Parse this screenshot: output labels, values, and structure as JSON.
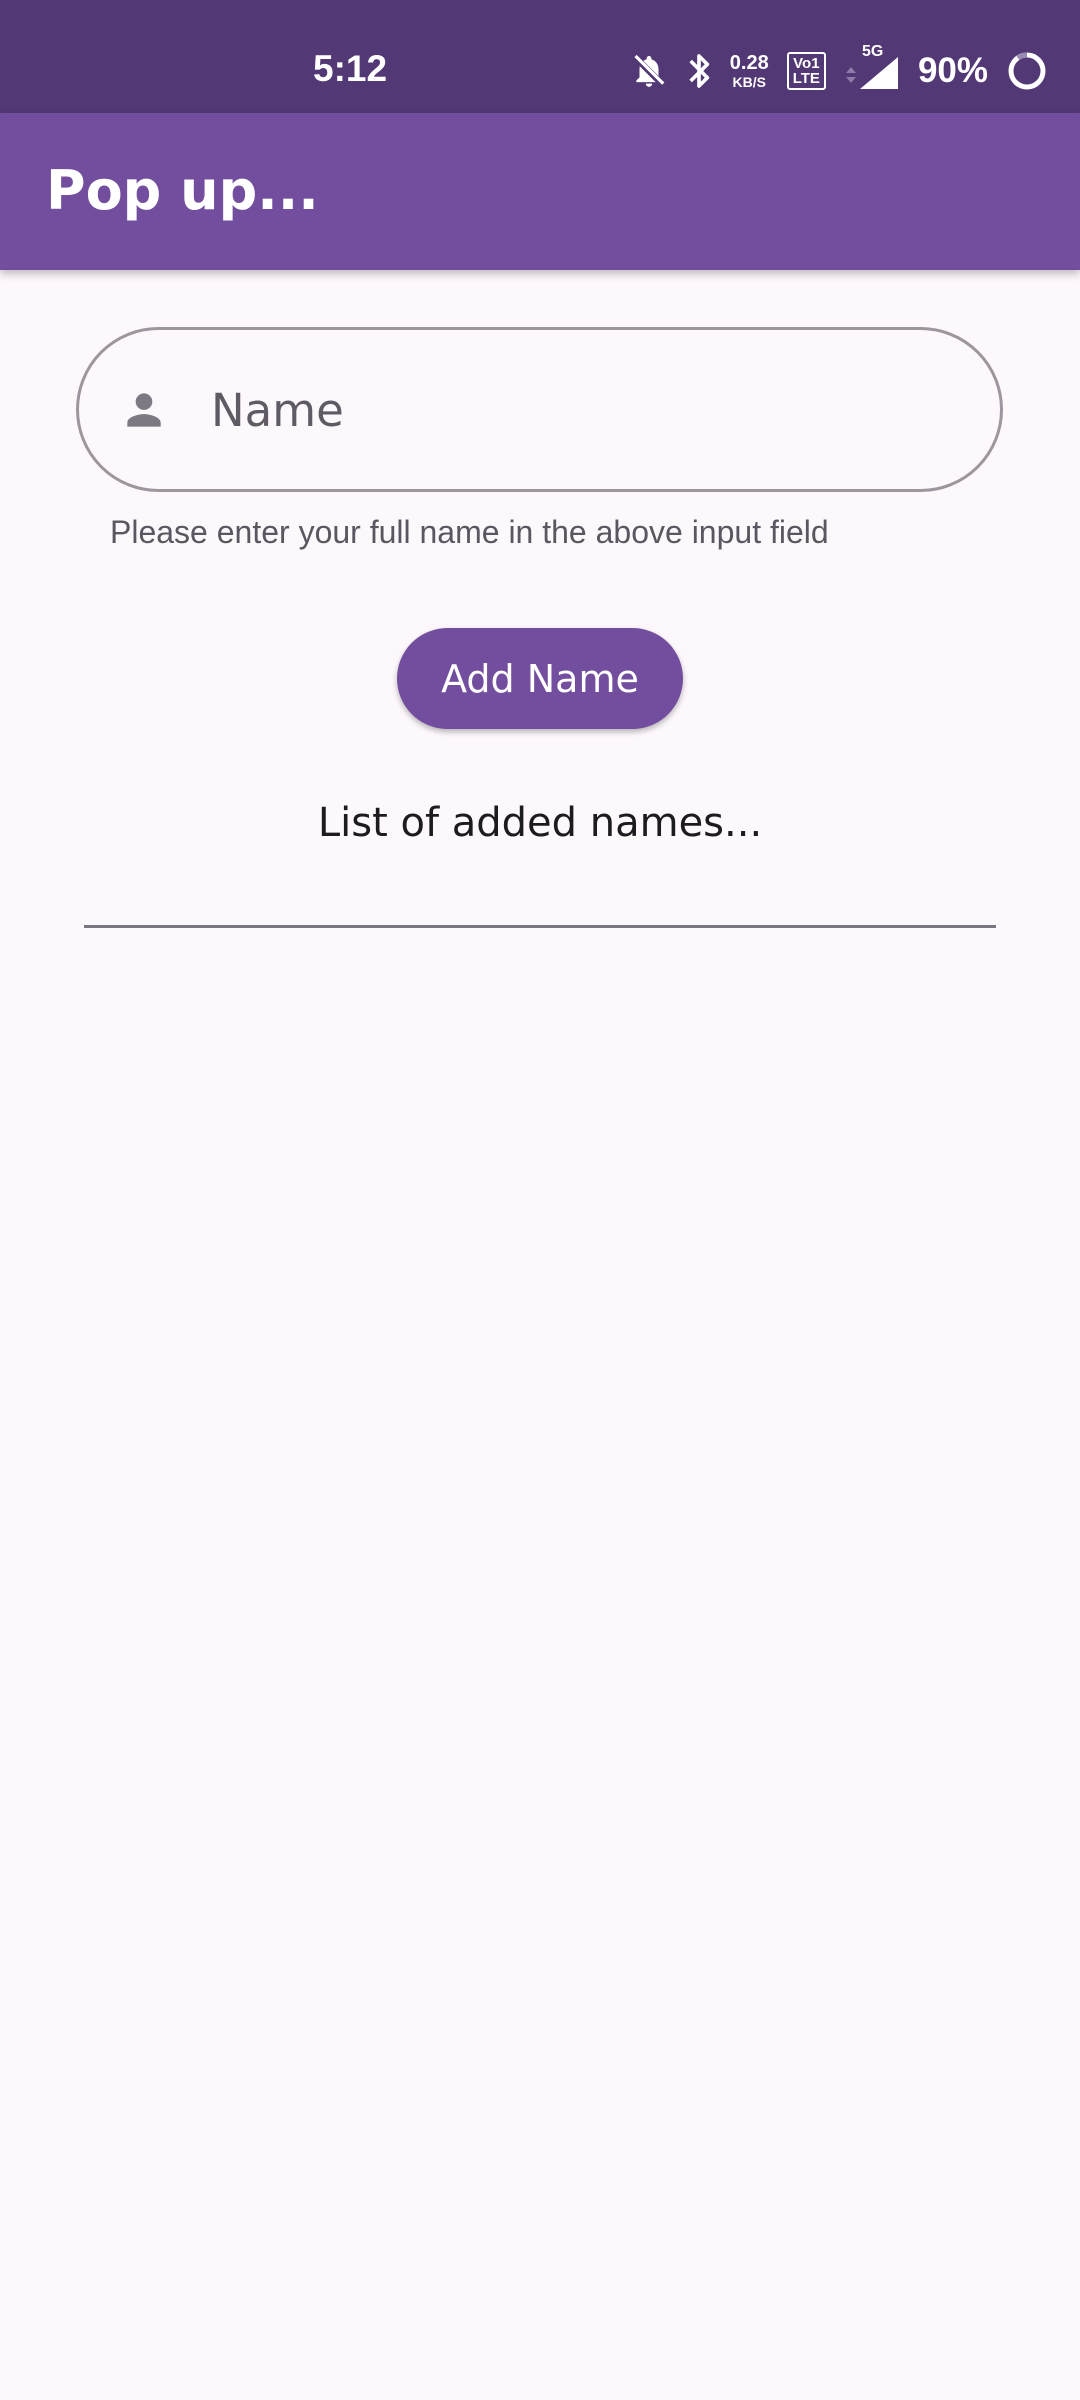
{
  "status_bar": {
    "time": "5:12",
    "net_speed_value": "0.28",
    "net_speed_unit": "KB/S",
    "volte_top": "Vo",
    "volte_bottom": "LTE",
    "sim_slot": "1",
    "network_type": "5G",
    "battery_percent": "90%",
    "icons": [
      "bell-off-icon",
      "bluetooth-icon",
      "volte-icon",
      "signal-icon",
      "battery-ring-icon"
    ]
  },
  "app_bar": {
    "title": "Pop up..."
  },
  "form": {
    "name_placeholder": "Name",
    "name_value": "",
    "leading_icon": "person-icon",
    "helper_text": "Please enter your full name in the above input field",
    "add_button_label": "Add Name"
  },
  "list": {
    "heading": "List of added names...",
    "items": []
  },
  "colors": {
    "status_bar": "#523874",
    "app_bar": "#734E9F",
    "button": "#734E9F",
    "background": "#FDF8FC",
    "input_border": "#9E969F"
  }
}
